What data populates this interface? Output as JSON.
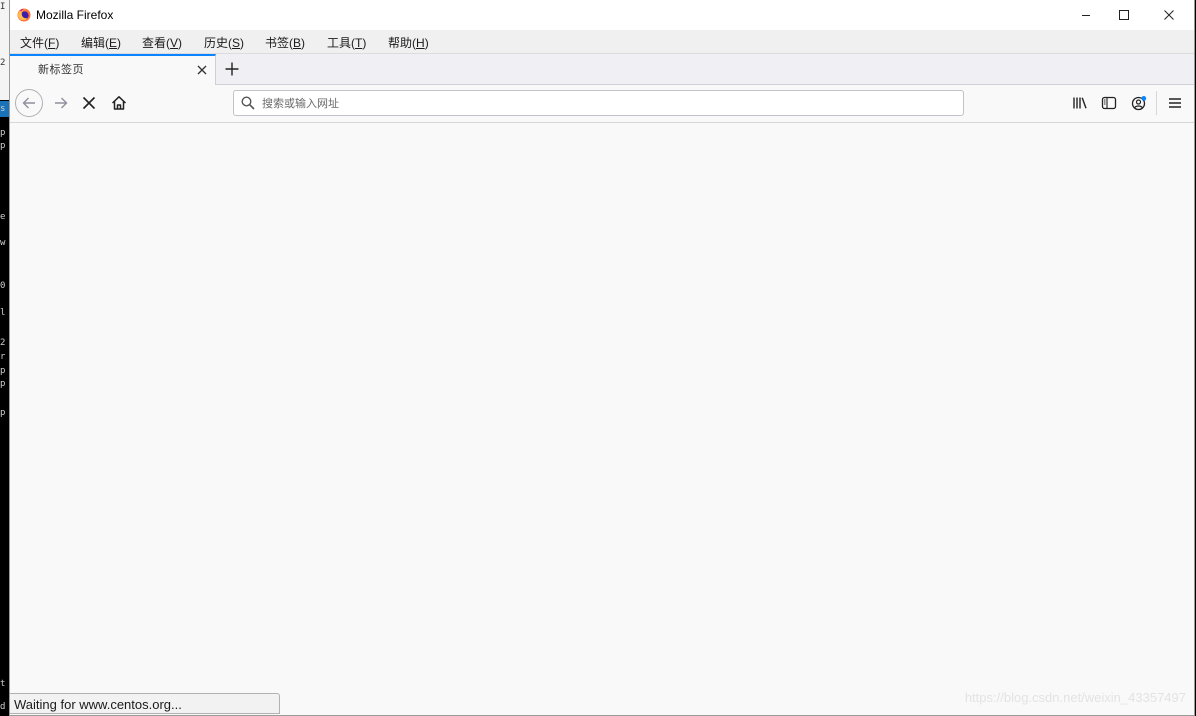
{
  "window": {
    "title": "Mozilla Firefox"
  },
  "menubar": {
    "items": [
      {
        "label": "文件",
        "key": "F"
      },
      {
        "label": "编辑",
        "key": "E"
      },
      {
        "label": "查看",
        "key": "V"
      },
      {
        "label": "历史",
        "key": "S"
      },
      {
        "label": "书签",
        "key": "B"
      },
      {
        "label": "工具",
        "key": "T"
      },
      {
        "label": "帮助",
        "key": "H"
      }
    ]
  },
  "tab": {
    "title": "新标签页"
  },
  "urlbar": {
    "value": "",
    "placeholder": "搜索或输入网址"
  },
  "status": {
    "text": "Waiting for www.centos.org..."
  },
  "watermark": "https://blog.csdn.net/weixin_43357497",
  "terminal": [
    "I",
    "2",
    "s",
    "p",
    "p",
    "e",
    "w",
    "0",
    "l",
    "2",
    "r",
    "p",
    "p",
    "p",
    "t",
    "d"
  ],
  "colors": {
    "tab_accent": "#0a84ff",
    "terminal_highlight": "#1a73b8"
  },
  "icons": [
    "firefox-logo",
    "minimize-icon",
    "maximize-icon",
    "close-icon",
    "tab-close-icon",
    "plus-icon",
    "back-icon",
    "forward-icon",
    "stop-icon",
    "home-icon",
    "search-icon",
    "library-icon",
    "sidebar-icon",
    "account-icon",
    "hamburger-menu-icon"
  ]
}
